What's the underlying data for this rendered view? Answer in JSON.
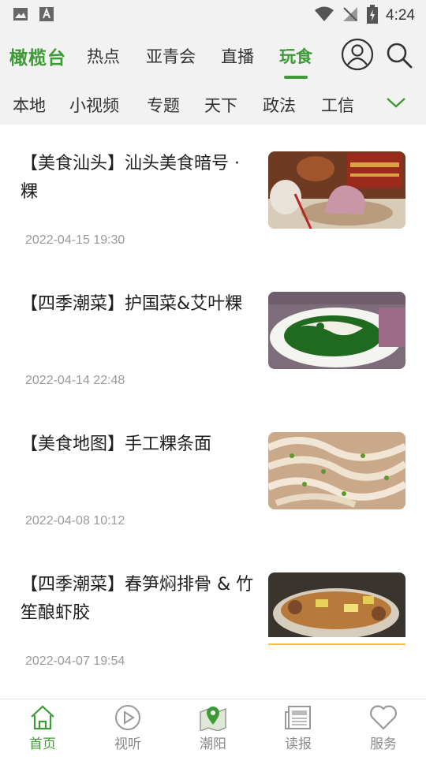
{
  "status_bar": {
    "time": "4:24"
  },
  "brand": "橄榄台",
  "tabs": [
    {
      "label": "热点",
      "active": false
    },
    {
      "label": "亚青会",
      "active": false
    },
    {
      "label": "直播",
      "active": false
    },
    {
      "label": "玩食",
      "active": true
    }
  ],
  "sub_tabs": [
    "本地",
    "小视频",
    "专题",
    "天下",
    "政法",
    "工信"
  ],
  "articles": [
    {
      "title": "【美食汕头】汕头美食暗号 · 粿",
      "date": "2022-04-15 19:30"
    },
    {
      "title": "【四季潮菜】护国菜&艾叶粿",
      "date": "2022-04-14 22:48"
    },
    {
      "title": "【美食地图】手工粿条面",
      "date": "2022-04-08 10:12"
    },
    {
      "title": "【四季潮菜】春笋焖排骨 & 竹笙酿虾胶",
      "date": "2022-04-07 19:54"
    }
  ],
  "bottom_nav": [
    {
      "label": "首页",
      "icon": "home-icon",
      "active": true
    },
    {
      "label": "视听",
      "icon": "play-circle-icon",
      "active": false
    },
    {
      "label": "潮阳",
      "icon": "map-pin-icon",
      "active": false
    },
    {
      "label": "读报",
      "icon": "newspaper-icon",
      "active": false
    },
    {
      "label": "服务",
      "icon": "heart-icon",
      "active": false
    }
  ],
  "colors": {
    "accent": "#3d9b35",
    "header_bg": "#f2f2f2",
    "date_text": "#9a9a9a"
  }
}
